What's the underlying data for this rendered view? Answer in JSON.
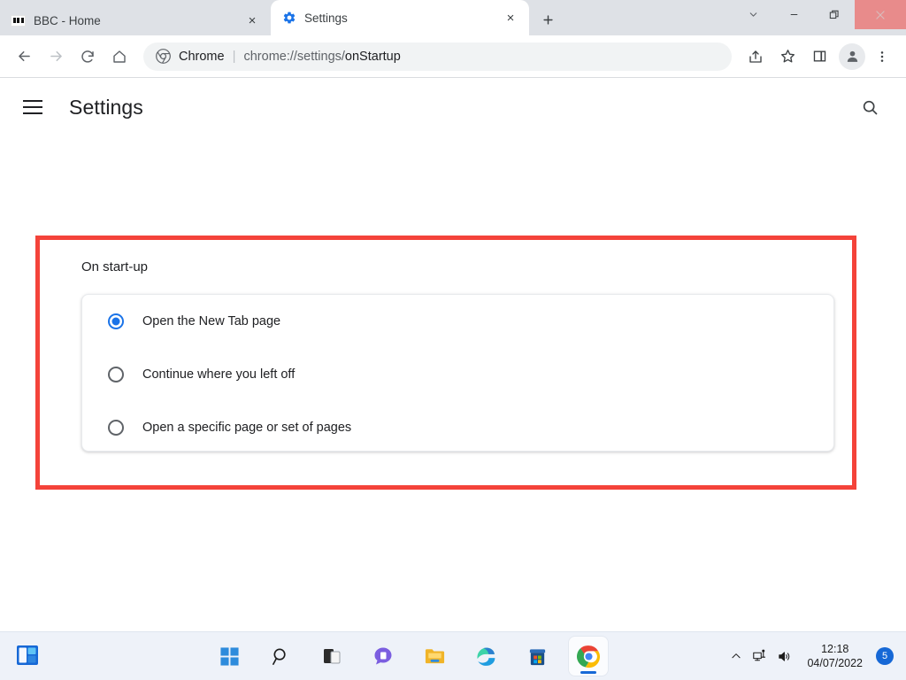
{
  "window": {
    "controls": {
      "tab_search": "chevron-down",
      "minimize": "minimize",
      "restore": "restore",
      "close": "close"
    },
    "close_highlight_color": "#e88b8b"
  },
  "tabs": [
    {
      "title": "BBC - Home",
      "favicon": "bbc-blocks-icon",
      "active": false,
      "close_label": "×"
    },
    {
      "title": "Settings",
      "favicon": "gear-icon",
      "active": true,
      "close_label": "×"
    }
  ],
  "new_tab_label": "+",
  "toolbar": {
    "back": "back-arrow-icon",
    "forward": "forward-arrow-icon",
    "reload": "reload-icon",
    "home": "home-icon",
    "omnibox": {
      "app_name": "Chrome",
      "separator": "|",
      "url_scheme": "chrome://settings/",
      "url_path": "onStartup",
      "full_url": "chrome://settings/onStartup"
    },
    "share": "share-icon",
    "bookmark": "star-icon",
    "side_panel": "side-panel-icon",
    "profile": "profile-avatar-icon",
    "menu": "three-dot-menu-icon"
  },
  "settings": {
    "menu_label": "hamburger-menu",
    "title": "Settings",
    "search_label": "search-icon",
    "section": {
      "label": "On start-up",
      "options": [
        {
          "label": "Open the New Tab page",
          "selected": true
        },
        {
          "label": "Continue where you left off",
          "selected": false
        },
        {
          "label": "Open a specific page or set of pages",
          "selected": false
        }
      ]
    }
  },
  "annotation": {
    "color": "#f4433a",
    "border_width": "5px"
  },
  "colors": {
    "accent_blue": "#1a73e8",
    "tabstrip_bg": "#dee1e6",
    "taskbar_bg": "#eef2f9"
  },
  "taskbar": {
    "widgets": "widgets-icon",
    "items": [
      {
        "name": "start-icon"
      },
      {
        "name": "search-icon"
      },
      {
        "name": "task-view-icon"
      },
      {
        "name": "chat-icon"
      },
      {
        "name": "file-explorer-icon"
      },
      {
        "name": "edge-icon"
      },
      {
        "name": "microsoft-store-icon"
      },
      {
        "name": "chrome-icon"
      }
    ],
    "tray": {
      "overflow": "chevron-up-icon",
      "network": "network-icon",
      "volume": "volume-icon",
      "time": "12:18",
      "date": "04/07/2022",
      "badge_count": "5"
    }
  }
}
